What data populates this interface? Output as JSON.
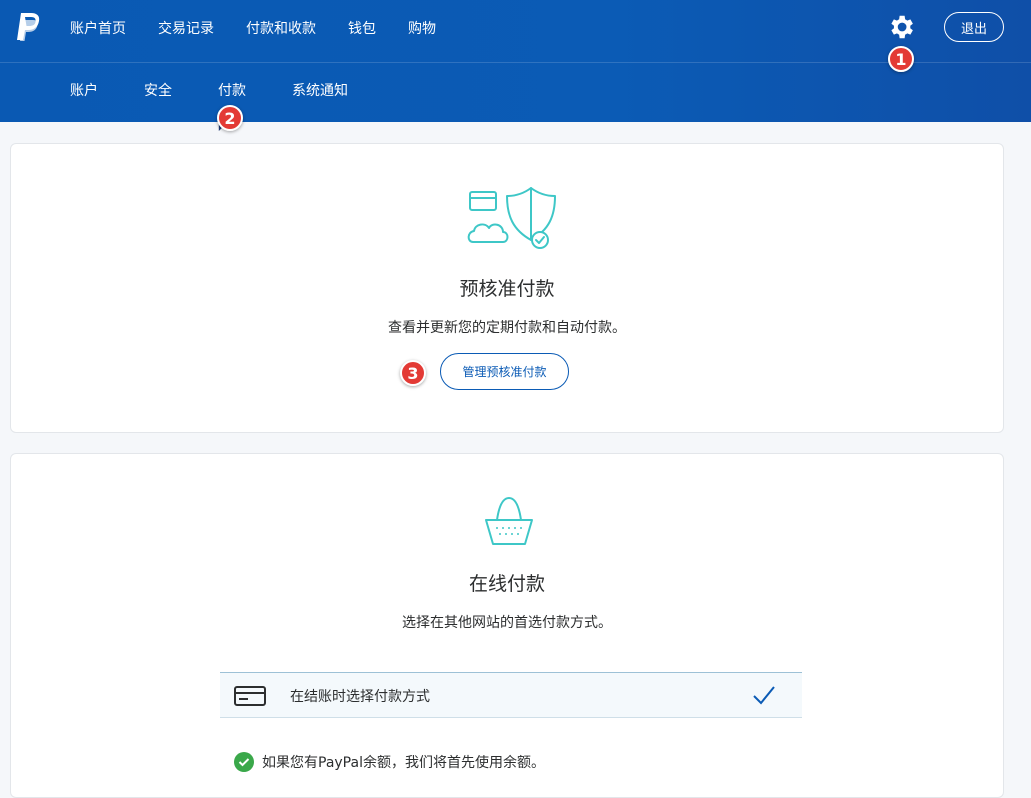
{
  "nav": {
    "top_items": [
      "账户首页",
      "交易记录",
      "付款和收款",
      "钱包",
      "购物"
    ],
    "logout_label": "退出",
    "sub_items": [
      "账户",
      "安全",
      "付款",
      "系统通知"
    ],
    "active_sub": "付款"
  },
  "annotations": [
    "1",
    "2",
    "3"
  ],
  "preapproved": {
    "title": "预核准付款",
    "description": "查看并更新您的定期付款和自动付款。",
    "button_label": "管理预核准付款"
  },
  "online": {
    "title": "在线付款",
    "description": "选择在其他网站的首选付款方式。",
    "option_label": "在结账时选择付款方式",
    "note": "如果您有PayPal余额，我们将首先使用余额。"
  },
  "colors": {
    "header": "#0b5bb5",
    "badge": "#e33a35",
    "accent_teal": "#3ec7c7",
    "success": "#3aa84a"
  },
  "icons": [
    "paypal-logo",
    "gear-icon",
    "credit-card-cloud-shield-icon",
    "shopping-basket-icon",
    "card-icon",
    "checkmark-icon",
    "check-circle-icon"
  ]
}
